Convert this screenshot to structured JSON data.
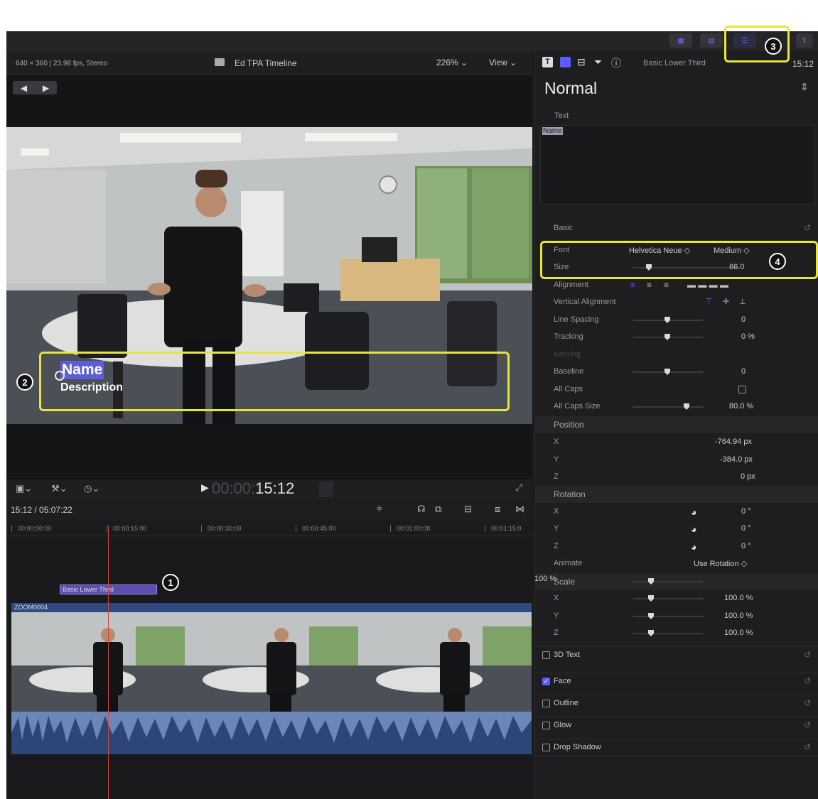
{
  "viewer": {
    "format": "640 × 360 | 23.98 fps, Stereo",
    "project": "Ed TPA Timeline",
    "zoom": "226%",
    "view": "View"
  },
  "title_overlay": {
    "name": "Name",
    "description": "Description"
  },
  "transport": {
    "timecode_dim": "00:00:",
    "timecode": "15:12"
  },
  "timeline": {
    "position": "15:12 / 05:07:22",
    "ruler": [
      "00:00:00:00",
      "00:00:15:00",
      "00:00:30:00",
      "00:00:45:00",
      "00:01:00:00",
      "00:01:15:0"
    ],
    "title_clip": "Basic Lower Third",
    "video_clip": "ZOOM0004"
  },
  "inspector": {
    "header_title": "Basic Lower Third",
    "header_time": "15:12",
    "preset": "Normal",
    "text_label": "Text",
    "text_value": "Name",
    "basic": "Basic",
    "font_label": "Font",
    "font_family": "Helvetica Neue ◇",
    "font_weight": "Medium ◇",
    "size_label": "Size",
    "size_value": "66.0",
    "alignment": "Alignment",
    "vertical_alignment": "Vertical Alignment",
    "line_spacing": "Line Spacing",
    "line_spacing_value": "0",
    "tracking": "Tracking",
    "tracking_value": "0 %",
    "kerning": "Kerning",
    "baseline": "Baseline",
    "baseline_value": "0",
    "all_caps": "All Caps",
    "all_caps_size": "All Caps Size",
    "all_caps_size_value": "80.0 %",
    "position": "Position",
    "pos_x": "-764.94 px",
    "pos_y": "-384.0 px",
    "pos_z": "0 px",
    "rotation": "Rotation",
    "rot_x": "0 °",
    "rot_y": "0 °",
    "rot_z": "0 °",
    "animate": "Animate",
    "animate_value": "Use Rotation ◇",
    "scale": "Scale",
    "scale_value": "100 %",
    "scale_x": "100.0 %",
    "scale_y": "100.0 %",
    "scale_z": "100.0 %",
    "axis_x": "X",
    "axis_y": "Y",
    "axis_z": "Z",
    "text3d": "3D Text",
    "face": "Face",
    "outline": "Outline",
    "glow": "Glow",
    "drop_shadow": "Drop Shadow"
  },
  "callouts": [
    "1",
    "2",
    "3",
    "4"
  ],
  "colors": {
    "highlight": "#e8e53a",
    "accent": "#5b5bff",
    "title_clip": "#5a4fb0",
    "video_clip": "#3e5c96"
  }
}
